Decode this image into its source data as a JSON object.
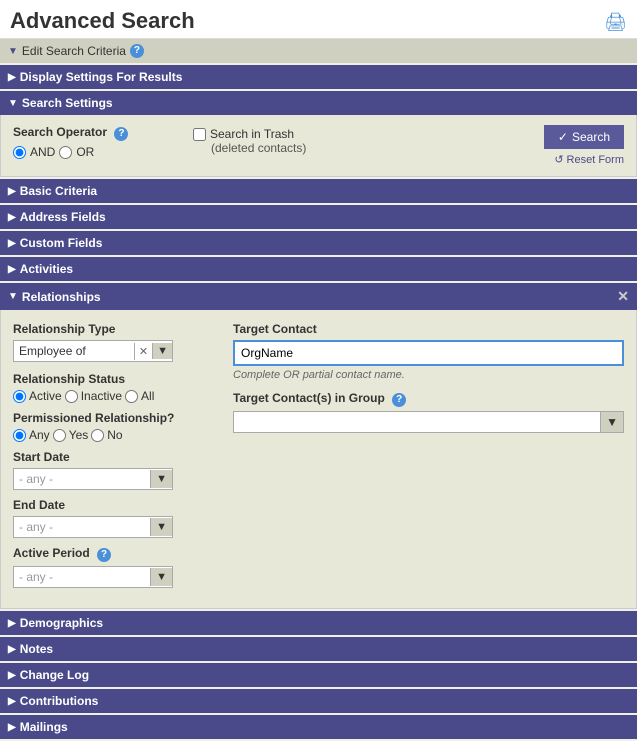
{
  "header": {
    "title": "Advanced Search",
    "print_icon": "🖨"
  },
  "edit_search": {
    "label": "Edit Search Criteria",
    "has_help": true
  },
  "display_settings": {
    "label": "Display Settings For Results"
  },
  "search_settings": {
    "label": "Search Settings",
    "operator_label": "Search Operator",
    "and_label": "AND",
    "or_label": "OR",
    "trash_checkbox_label": "Search in Trash",
    "trash_sub_label": "(deleted contacts)",
    "search_button_label": "Search",
    "reset_label": "Reset Form"
  },
  "sections": {
    "basic_criteria": "Basic Criteria",
    "address_fields": "Address Fields",
    "custom_fields": "Custom Fields",
    "activities": "Activities"
  },
  "relationships": {
    "label": "Relationships",
    "rel_type_label": "Relationship Type",
    "rel_type_value": "Employee of",
    "target_contact_label": "Target Contact",
    "target_contact_value": "OrgName",
    "target_contact_hint": "Complete OR partial contact name.",
    "target_group_label": "Target Contact(s) in Group",
    "target_group_placeholder": "",
    "rel_status_label": "Relationship Status",
    "active_label": "Active",
    "inactive_label": "Inactive",
    "all_label": "All",
    "permissioned_label": "Permissioned Relationship?",
    "any_label": "Any",
    "yes_label": "Yes",
    "no_label": "No",
    "start_date_label": "Start Date",
    "start_date_placeholder": "- any -",
    "end_date_label": "End Date",
    "end_date_placeholder": "- any -",
    "active_period_label": "Active Period",
    "active_period_placeholder": "- any -"
  },
  "bottom_sections": {
    "demographics": "Demographics",
    "notes": "Notes",
    "change_log": "Change Log",
    "contributions": "Contributions",
    "mailings": "Mailings"
  }
}
